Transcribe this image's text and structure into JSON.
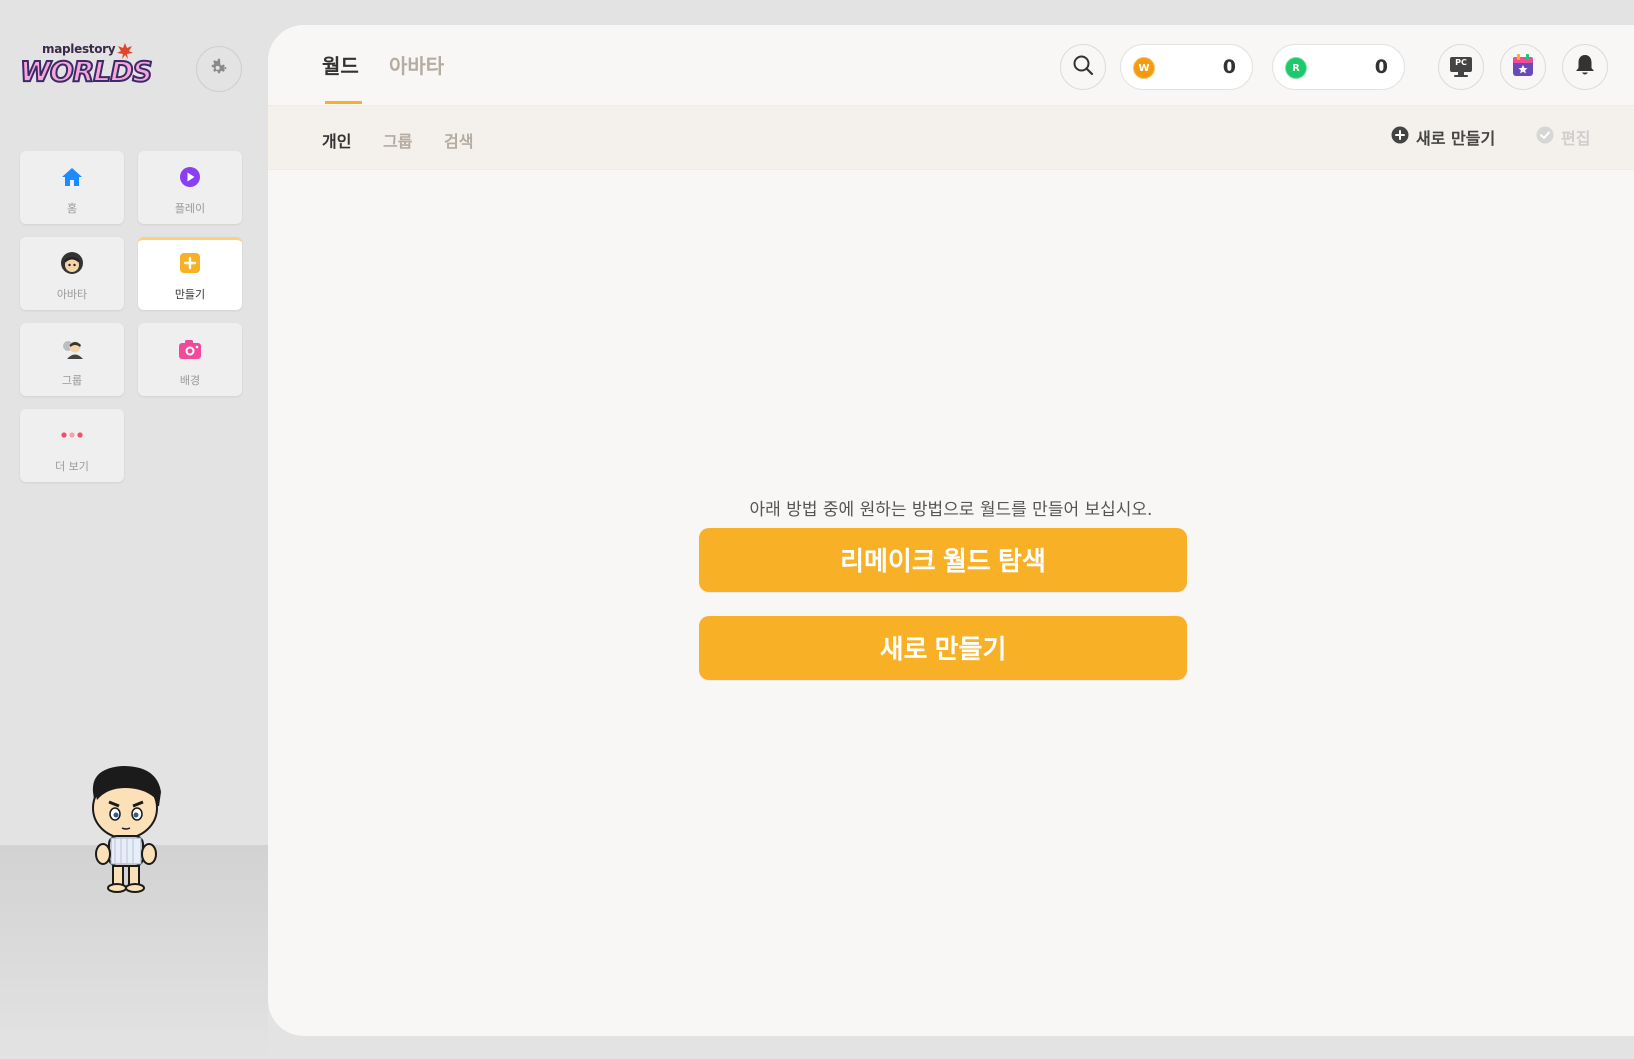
{
  "brand": {
    "small": "maplestory",
    "big": "WORLDS"
  },
  "sidebar": {
    "items": [
      {
        "label": "홈",
        "icon": "home-icon",
        "color": "#1a8cff"
      },
      {
        "label": "플레이",
        "icon": "play-icon",
        "color": "#8a3ff2"
      },
      {
        "label": "아바타",
        "icon": "avatar-face-icon",
        "color": "#333333"
      },
      {
        "label": "만들기",
        "icon": "create-plus-icon",
        "color": "#f8b027",
        "active": true
      },
      {
        "label": "그룹",
        "icon": "group-icon",
        "color": "#777777"
      },
      {
        "label": "배경",
        "icon": "camera-icon",
        "color": "#f24a9a"
      },
      {
        "label": "더 보기",
        "icon": "more-dots-icon",
        "color": "#f0506e"
      }
    ]
  },
  "header": {
    "tabs": [
      {
        "label": "월드",
        "active": true
      },
      {
        "label": "아바타",
        "active": false
      }
    ],
    "currencies": [
      {
        "coin": "W",
        "amount": "0",
        "color": "#f39c12"
      },
      {
        "coin": "R",
        "amount": "0",
        "color": "#1ec96b"
      }
    ],
    "pc_label": "PC"
  },
  "subheader": {
    "tabs": [
      {
        "label": "개인",
        "active": true
      },
      {
        "label": "그룹",
        "active": false
      },
      {
        "label": "검색",
        "active": false
      }
    ],
    "new_label": "새로 만들기",
    "edit_label": "편집"
  },
  "content": {
    "prompt": "아래 방법 중에 원하는 방법으로 월드를 만들어 보십시오.",
    "remake_button": "리메이크 월드 탐색",
    "new_button": "새로 만들기"
  },
  "colors": {
    "accent": "#f8b027",
    "background": "#f8f7f5",
    "sidebar_bg": "#e3e3e3"
  }
}
